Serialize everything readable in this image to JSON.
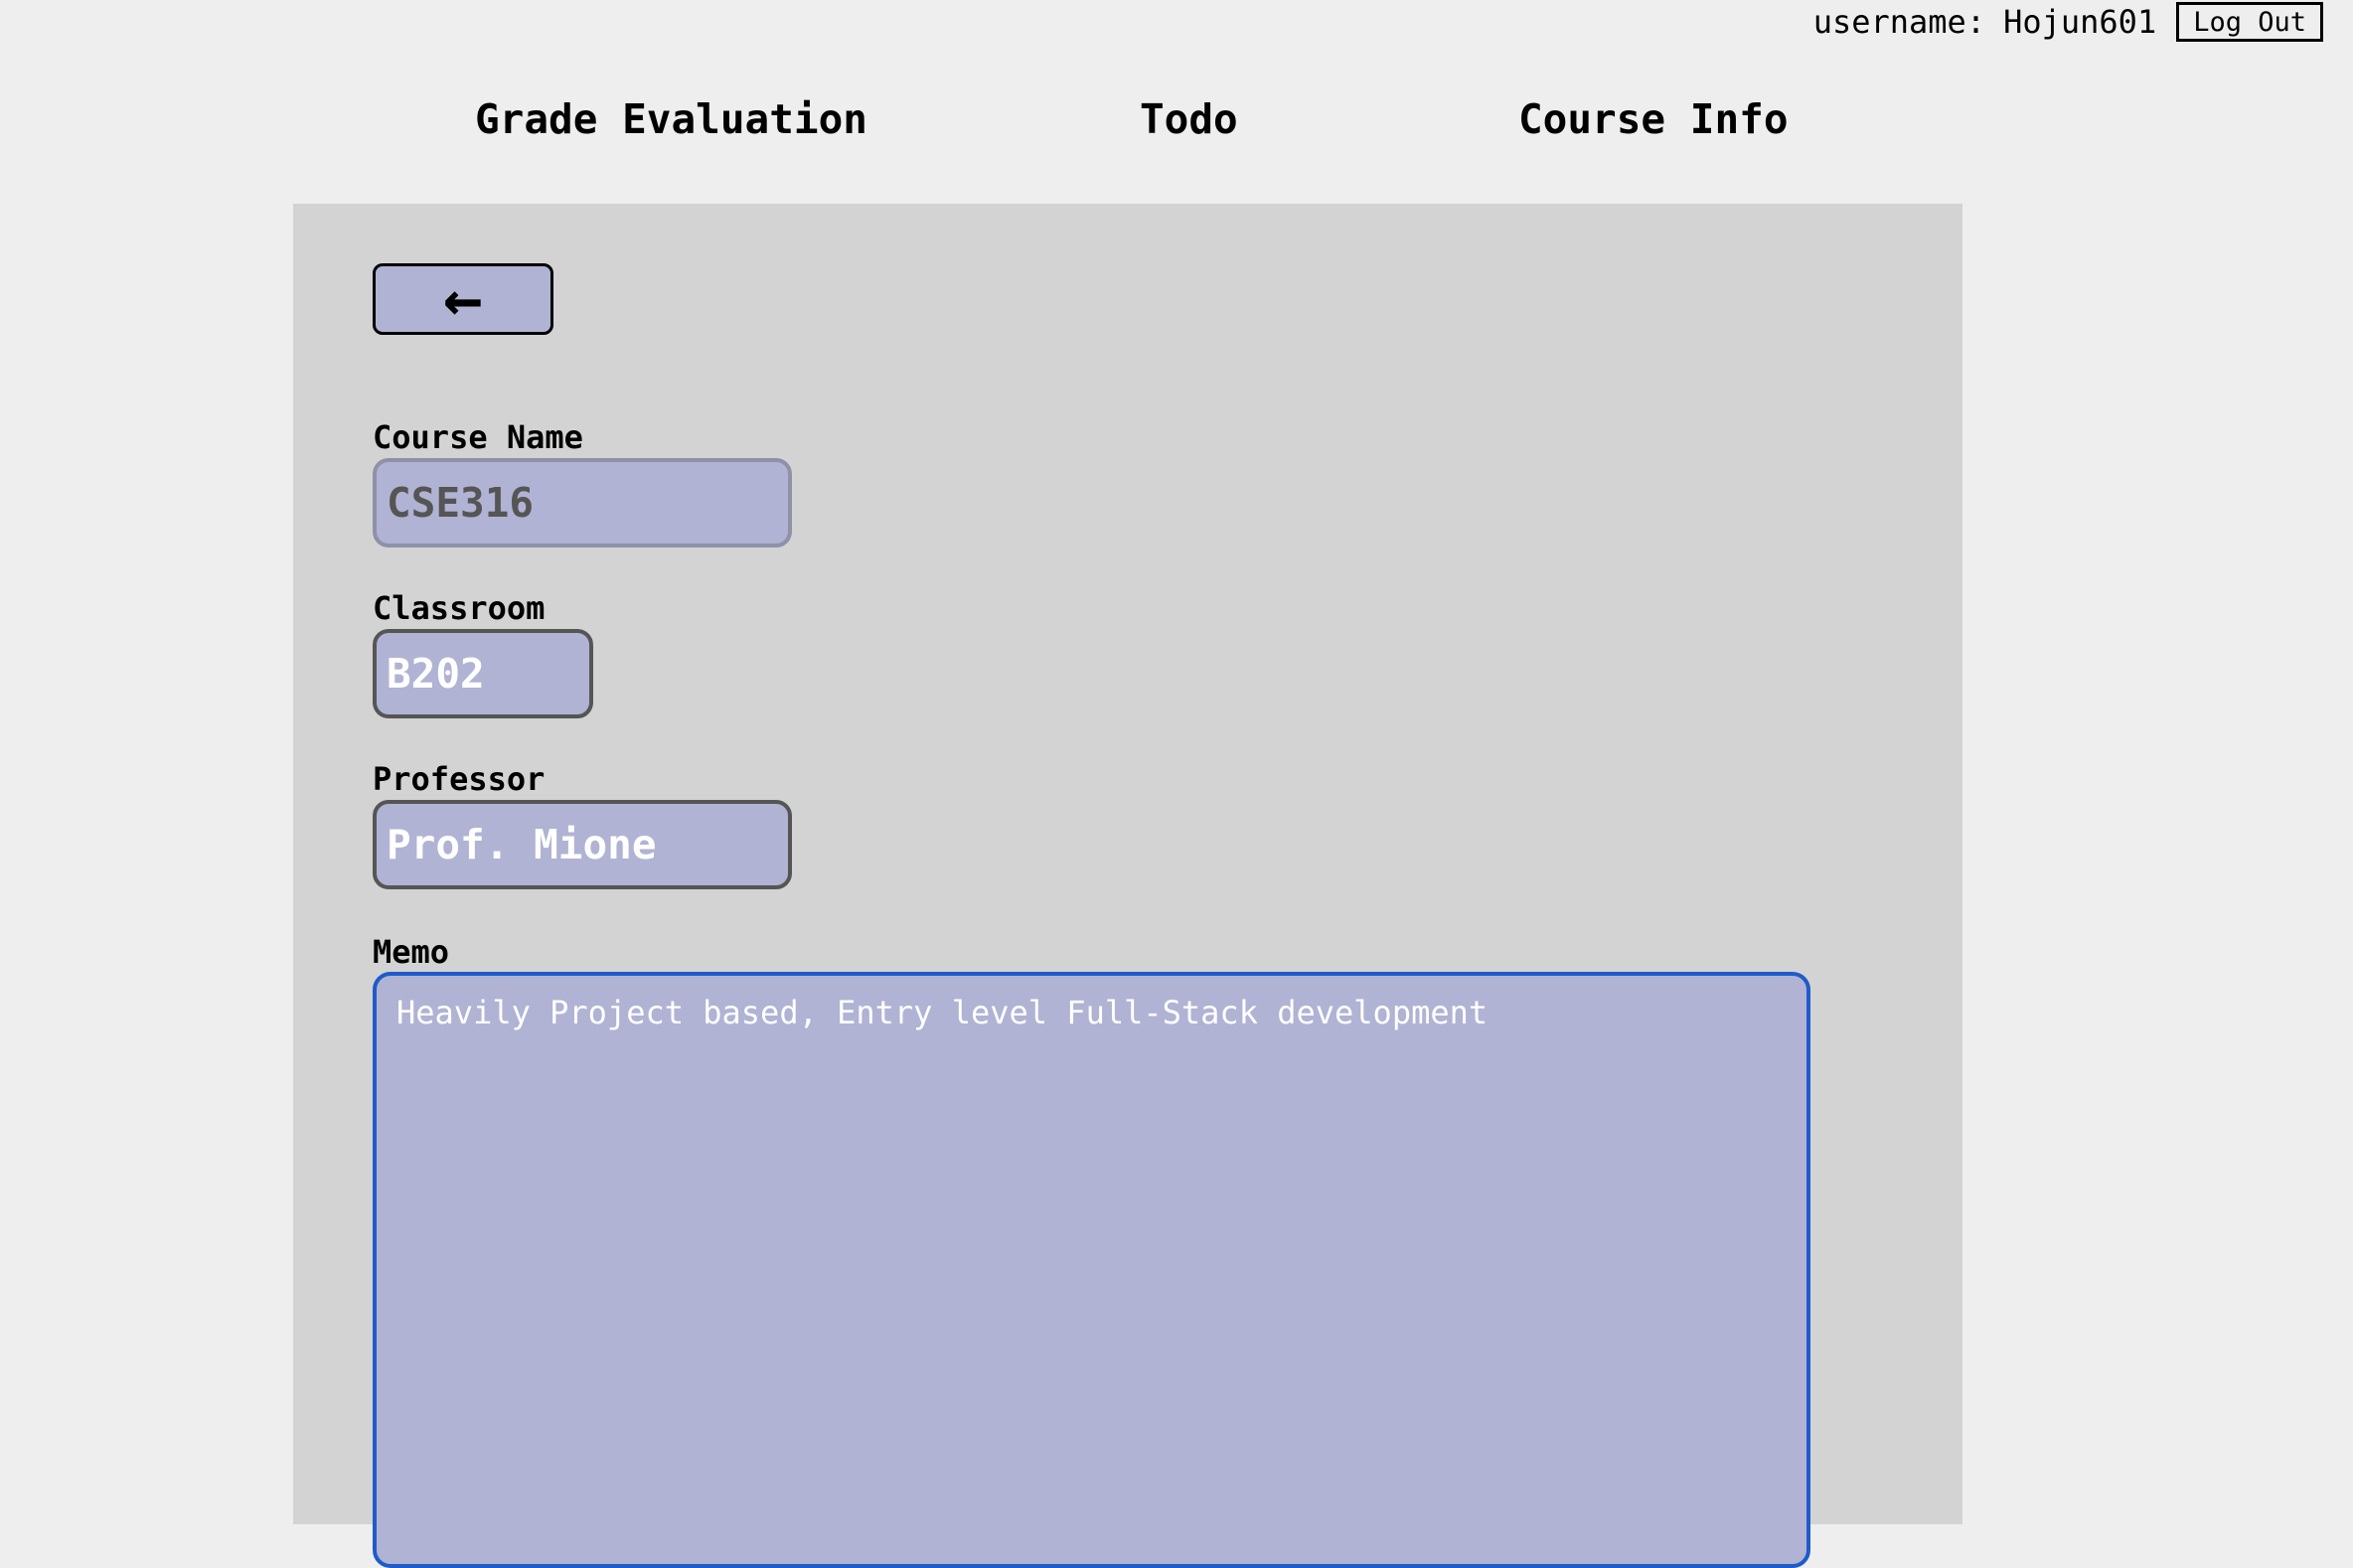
{
  "header": {
    "username_label": "username:",
    "username": "Hojun601",
    "logout_label": "Log Out"
  },
  "nav": {
    "items": [
      {
        "label": "Grade Evaluation"
      },
      {
        "label": "Todo"
      },
      {
        "label": "Course Info"
      }
    ]
  },
  "form": {
    "back_label": "←",
    "course_name": {
      "label": "Course Name",
      "value": "CSE316"
    },
    "classroom": {
      "label": "Classroom",
      "value": "B202"
    },
    "professor": {
      "label": "Professor",
      "value": "Prof. Mione"
    },
    "memo": {
      "label": "Memo",
      "value": "Heavily Project based, Entry level Full-Stack development"
    }
  }
}
